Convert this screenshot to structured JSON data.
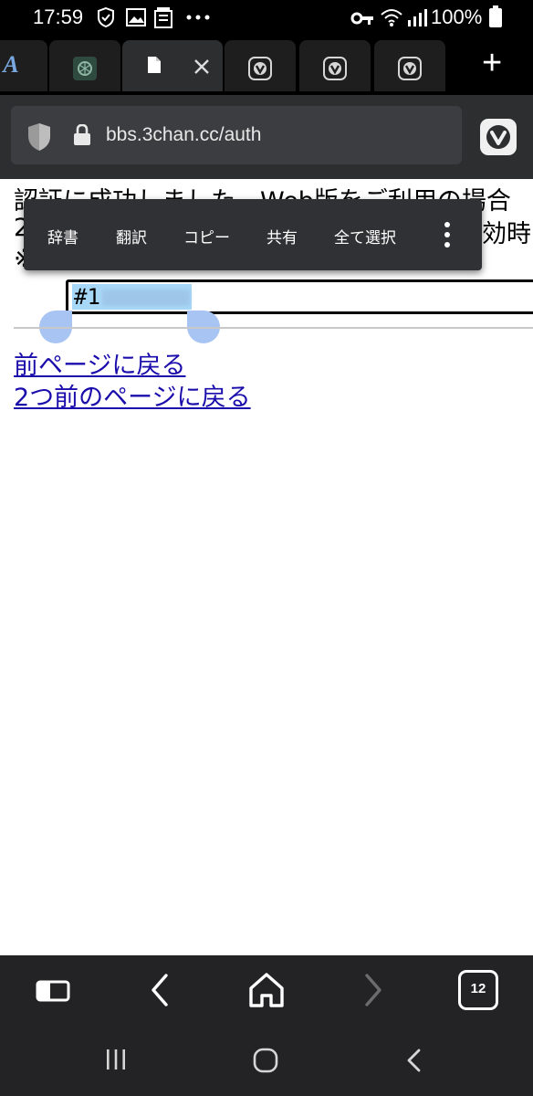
{
  "status_bar": {
    "time": "17:59",
    "battery": "100%",
    "icons": [
      "shield-icon",
      "gallery-icon",
      "notification-icon",
      "more-dots-icon",
      "key-icon",
      "wifi-icon",
      "signal-icon",
      "battery-icon"
    ]
  },
  "tabs": {
    "items": [
      {
        "icon": "a-favicon"
      },
      {
        "icon": "chatgpt-favicon"
      },
      {
        "icon": "document-favicon",
        "active": true
      },
      {
        "icon": "vivaldi-favicon"
      },
      {
        "icon": "vivaldi-favicon"
      },
      {
        "icon": "vivaldi-favicon"
      }
    ],
    "favicon_a": "A",
    "new_tab": "+"
  },
  "address_bar": {
    "url": "bbs.3chan.cc/auth"
  },
  "page": {
    "line1": "認証に成功しました。Web版をご利用の場合",
    "line2": "2",
    "line2_end": "効時",
    "line3": "※",
    "token_visible": "#1",
    "link_back": "前ページに戻る",
    "link_back2": "2つ前のページに戻る"
  },
  "context_menu": {
    "items": [
      "辞書",
      "翻訳",
      "コピー",
      "共有",
      "全て選択"
    ]
  },
  "bottom_toolbar": {
    "tab_count": "12"
  },
  "colors": {
    "link": "#1a0dab",
    "selection": "#a8d8f8",
    "handle": "#a7c4f3",
    "menu_bg": "#303134"
  }
}
